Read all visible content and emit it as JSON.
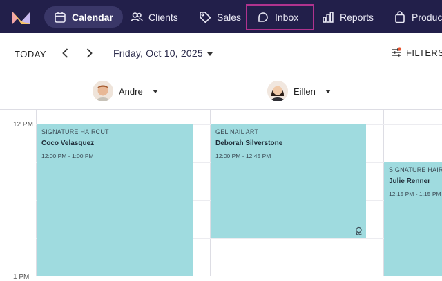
{
  "nav": {
    "items": [
      {
        "label": "Calendar",
        "icon": "calendar-icon"
      },
      {
        "label": "Clients",
        "icon": "users-icon"
      },
      {
        "label": "Sales",
        "icon": "tag-icon"
      },
      {
        "label": "Inbox",
        "icon": "chat-icon"
      },
      {
        "label": "Reports",
        "icon": "bar-chart-icon"
      },
      {
        "label": "Products",
        "icon": "bag-icon"
      }
    ],
    "active": "Calendar",
    "highlighted": "Inbox"
  },
  "toolbar": {
    "today_label": "TODAY",
    "date_label": "Friday, Oct 10, 2025",
    "filters_label": "FILTERS"
  },
  "staff": [
    {
      "name": "Andre"
    },
    {
      "name": "Eillen"
    }
  ],
  "time_labels": [
    "12 PM",
    "1 PM"
  ],
  "appointments": [
    {
      "service": "SIGNATURE HAIRCUT",
      "customer": "Coco Velasquez",
      "time": "12:00 PM - 1:00 PM"
    },
    {
      "service": "GEL NAIL ART",
      "customer": "Deborah Silverstone",
      "time": "12:00 PM - 12:45 PM"
    },
    {
      "service": "SIGNATURE HAIRCUT",
      "customer": "Julie Renner",
      "time": "12:15 PM - 1:15 PM"
    }
  ],
  "colors": {
    "nav_bg": "#221f4a",
    "appointment": "#9fdbdf",
    "highlight_border": "#b0338e",
    "filter_dot": "#e8542f"
  }
}
